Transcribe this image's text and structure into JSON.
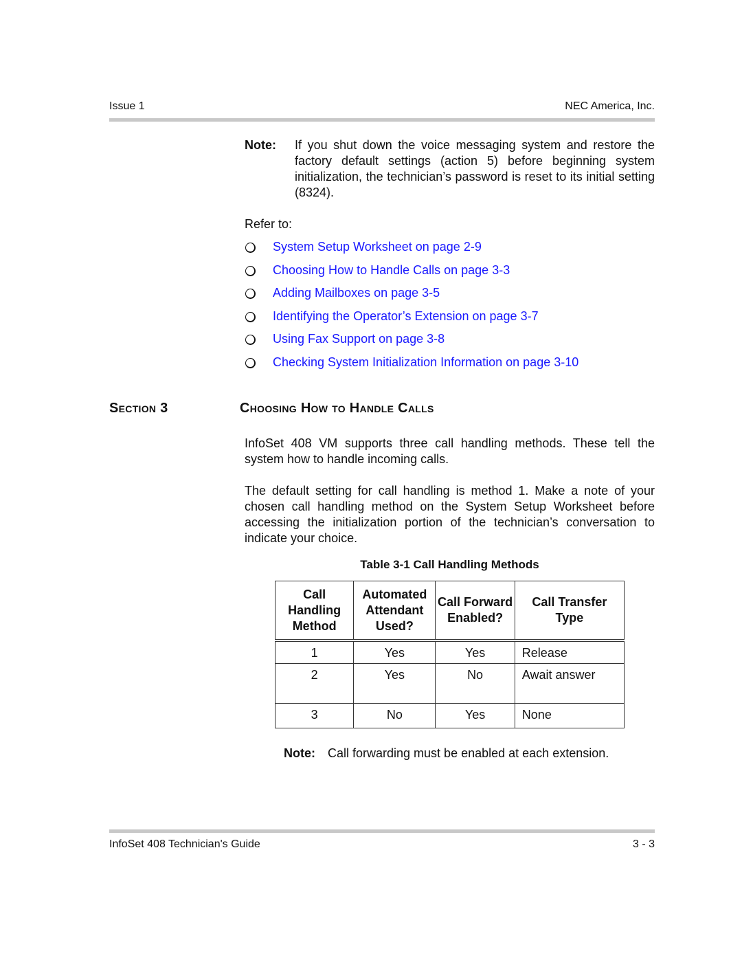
{
  "header": {
    "left": "Issue 1",
    "right": "NEC America, Inc."
  },
  "note1": {
    "label": "Note:",
    "text": "If you shut down the voice messaging system and restore the factory default settings (action 5) before beginning system initialization, the technician’s password is reset to its initial setting (8324)."
  },
  "refer_to": "Refer to:",
  "links": [
    "System Setup Worksheet on page 2-9",
    "Choosing How to Handle Calls on page 3-3",
    "Adding Mailboxes on page 3-5",
    "Identifying the Operator’s Extension on page 3-7",
    "Using Fax Support on page 3-8",
    "Checking System Initialization Information on page 3-10"
  ],
  "bullet_icon": "hollow-circle",
  "link_color": "#1a1aff",
  "section": {
    "label": "Section 3",
    "title": "Choosing How to Handle Calls"
  },
  "paragraphs": [
    "InfoSet 408 VM supports three call handling methods. These tell the system how to handle incoming calls.",
    "The default setting for call handling is method 1. Make a note of your chosen call handling method on the System Setup Worksheet before accessing the initialization portion of the technician’s conversation to indicate your choice."
  ],
  "table": {
    "caption": "Table 3-1  Call Handling Methods",
    "headers": [
      "Call Handling Method",
      "Automated Attendant Used?",
      "Call Forward Enabled?",
      "Call Transfer Type"
    ],
    "rows": [
      [
        "1",
        "Yes",
        "Yes",
        "Release"
      ],
      [
        "2",
        "Yes",
        "No",
        "Await answer"
      ],
      [
        "3",
        "No",
        "Yes",
        "None"
      ]
    ]
  },
  "note2": {
    "label": "Note:",
    "text": "Call forwarding must be enabled at each extension."
  },
  "footer": {
    "left": "InfoSet 408 Technician's Guide",
    "right": "3 - 3"
  }
}
